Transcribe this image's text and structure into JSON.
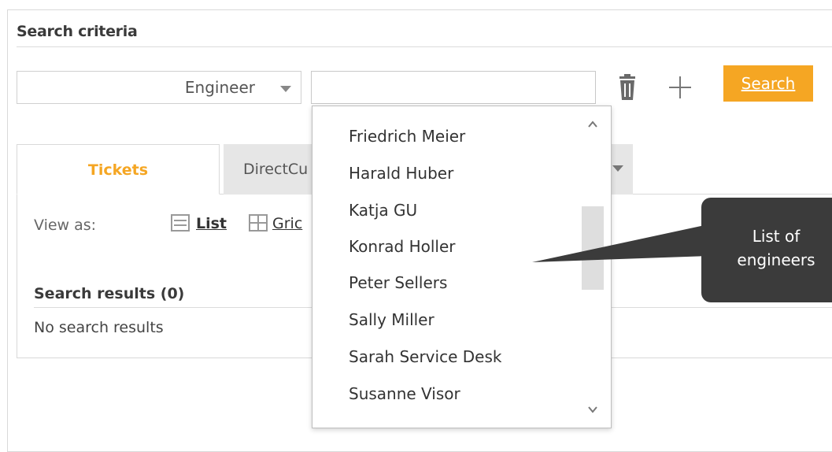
{
  "criteria": {
    "title": "Search criteria",
    "field_select_value": "Engineer",
    "value_input": "",
    "search_label": "Search"
  },
  "tabs": [
    {
      "label": "Tickets",
      "active": true
    },
    {
      "label": "DirectCu",
      "active": false
    }
  ],
  "view": {
    "label": "View as:",
    "list_label": "List",
    "grid_label": "Gric"
  },
  "results": {
    "title": "Search results (0)",
    "empty_text": "No search results"
  },
  "dropdown": {
    "items": [
      "Friedrich Meier",
      "Harald Huber",
      "Katja GU",
      "Konrad Holler",
      "Peter Sellers",
      "Sally Miller",
      "Sarah Service Desk",
      "Susanne Visor"
    ]
  },
  "callout": {
    "line1": "List of",
    "line2": "engineers"
  },
  "colors": {
    "accent": "#f5a623",
    "callout_bg": "#3b3b3b"
  },
  "icons": [
    "trash-icon",
    "plus-icon",
    "list-view-icon",
    "grid-view-icon",
    "chevron-up-icon",
    "chevron-down-icon",
    "dropdown-arrow-icon"
  ]
}
